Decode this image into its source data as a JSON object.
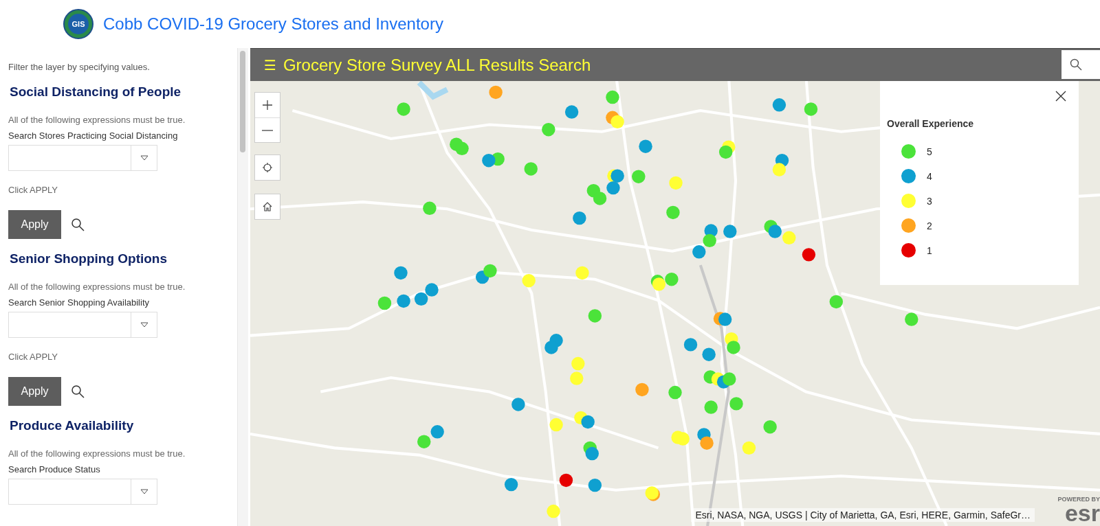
{
  "header": {
    "title": "Cobb COVID-19 Grocery Stores and Inventory",
    "logo_text": "GIS"
  },
  "filter_panel": {
    "intro": "Filter the layer by specifying values.",
    "sections": [
      {
        "heading": "Social Distancing of People",
        "hint": "All of the following expressions must be true.",
        "label": "Search Stores Practicing Social Distancing",
        "instruction": "Click APPLY",
        "button": "Apply"
      },
      {
        "heading": "Senior Shopping Options",
        "hint": "All of the following expressions must be true.",
        "label": "Search Senior Shopping Availability",
        "instruction": "Click APPLY",
        "button": "Apply"
      },
      {
        "heading": "Produce Availability",
        "hint": "All of the following expressions must be true.",
        "label": "Search Produce Status"
      }
    ]
  },
  "map": {
    "title_bar": {
      "menu_glyph": "☰",
      "title": "Grocery Store Survey ALL Results Search"
    },
    "legend": {
      "title": "Overall Experience",
      "items": [
        {
          "label": "5",
          "color": "#4be33a"
        },
        {
          "label": "4",
          "color": "#0fa0d0"
        },
        {
          "label": "3",
          "color": "#ffff33"
        },
        {
          "label": "2",
          "color": "#ffa520"
        },
        {
          "label": "1",
          "color": "#e60000"
        }
      ]
    },
    "attribution": "Esri, NASA, NGA, USGS | City of Marietta, GA, Esri, HERE, Garmin, SafeGr…",
    "logo": {
      "caption": "POWERED BY",
      "text": "esr"
    }
  }
}
